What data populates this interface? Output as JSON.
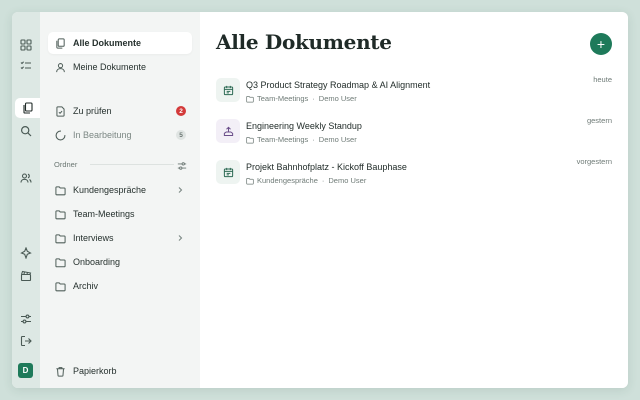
{
  "colors": {
    "accent": "#1e7a5a",
    "badge_red": "#d33a3a",
    "thumb_green": "#eef4f1",
    "thumb_purple": "#f3eff7"
  },
  "rail": {
    "avatar_initial": "D"
  },
  "sidebar": {
    "items": [
      {
        "label": "Alle Dokumente",
        "icon": "documents-icon"
      },
      {
        "label": "Meine Dokumente",
        "icon": "user-icon"
      },
      {
        "label": "Zu prüfen",
        "icon": "doc-check-icon",
        "badge": "2"
      },
      {
        "label": "In Bearbeitung",
        "icon": "spinner-icon",
        "badge": "5"
      }
    ],
    "folders_label": "Ordner",
    "folders": [
      {
        "label": "Kundengespräche",
        "has_children": true
      },
      {
        "label": "Team-Meetings",
        "has_children": false
      },
      {
        "label": "Interviews",
        "has_children": true
      },
      {
        "label": "Onboarding",
        "has_children": false
      },
      {
        "label": "Archiv",
        "has_children": false
      }
    ],
    "trash_label": "Papierkorb"
  },
  "main": {
    "title": "Alle Dokumente",
    "add_label": "+",
    "documents": [
      {
        "title": "Q3 Product Strategy Roadmap & AI Alignment",
        "folder": "Team-Meetings",
        "owner": "Demo User",
        "date": "heute",
        "icon": "calendar-icon"
      },
      {
        "title": "Engineering Weekly Standup",
        "folder": "Team-Meetings",
        "owner": "Demo User",
        "date": "gestern",
        "icon": "upload-icon"
      },
      {
        "title": "Projekt Bahnhofplatz - Kickoff Bauphase",
        "folder": "Kundengespräche",
        "owner": "Demo User",
        "date": "vorgestern",
        "icon": "calendar-icon"
      }
    ]
  }
}
